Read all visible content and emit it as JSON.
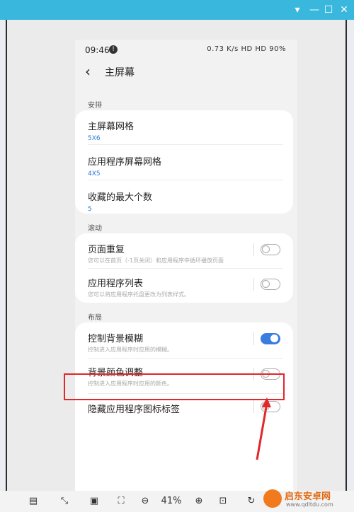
{
  "window": {
    "minimize": "—",
    "maximize": "☐",
    "close": "✕",
    "dropdown": "▾"
  },
  "status": {
    "time": "09:46",
    "dot": "!",
    "right": "0.73 K/s  HD  HD  90%"
  },
  "header": {
    "title": "主屏幕"
  },
  "sections": [
    {
      "label": "安排"
    },
    {
      "label": "滚动"
    },
    {
      "label": "布局"
    }
  ],
  "arrange": [
    {
      "title": "主屏幕网格",
      "value": "5X6"
    },
    {
      "title": "应用程序屏幕网格",
      "value": "4X5"
    },
    {
      "title": "收藏的最大个数",
      "value": "5"
    }
  ],
  "scroll": [
    {
      "title": "页面重复",
      "sub": "您可以在首页（-1页关闭）和应用程序中循环播放页面",
      "on": false
    },
    {
      "title": "应用程序列表",
      "sub": "您可以将应用程序托盘更改为列表样式。",
      "on": false
    }
  ],
  "layout": [
    {
      "title": "控制背景模糊",
      "sub": "控制进入应用程序时应用的模糊。",
      "on": true
    },
    {
      "title": "背景颜色调整",
      "sub": "控制进入应用程序时应用的颜色。",
      "on": false
    },
    {
      "title": "隐藏应用程序图标标签",
      "on": false
    }
  ],
  "toolbar": {
    "zoom": "41%"
  },
  "watermark": {
    "name": "启东安卓网",
    "url": "www.qdltdu.com"
  },
  "colors": {
    "titlebar": "#3ab7dc",
    "accent": "#3a7de0",
    "highlight": "#e2262a"
  }
}
